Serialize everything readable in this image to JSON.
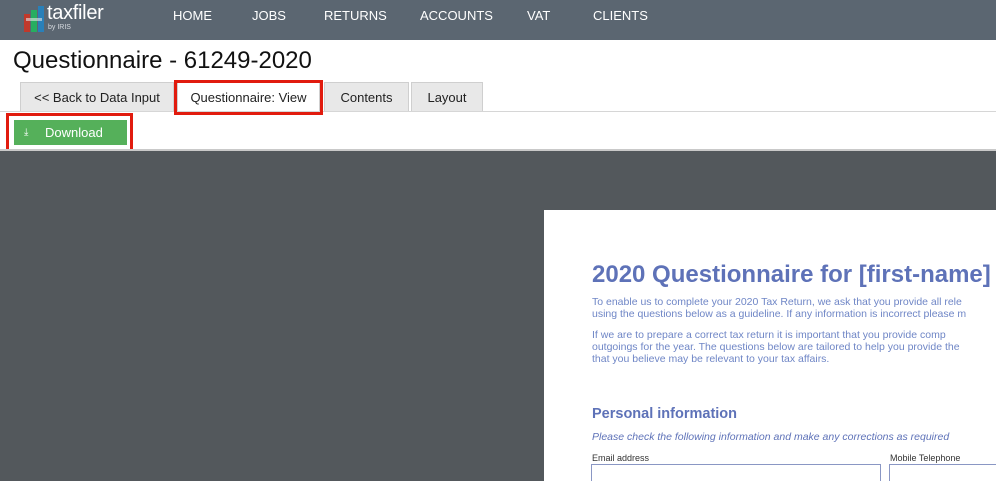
{
  "app": {
    "logo_text": "taxfiler",
    "logo_sub": "by IRIS"
  },
  "nav": {
    "items": [
      "HOME",
      "JOBS",
      "RETURNS",
      "ACCOUNTS",
      "VAT",
      "CLIENTS"
    ]
  },
  "page": {
    "title": "Questionnaire - 61249-2020"
  },
  "tabs": [
    {
      "label": "<< Back to Data Input"
    },
    {
      "label": "Questionnaire: View",
      "active": true
    },
    {
      "label": "Contents"
    },
    {
      "label": "Layout"
    }
  ],
  "toolbar": {
    "download_label": "Download",
    "download_icon": "download-icon"
  },
  "colors": {
    "nav_bg": "#5b6671",
    "accent_green": "#55b05a",
    "highlight_red": "#e11b0e",
    "viewer_bg": "#53585c",
    "doc_blue": "#5e72b8"
  },
  "document": {
    "title": "2020 Questionnaire for [first-name]",
    "paragraph1_line1": "To enable us to complete your 2020 Tax Return, we ask that you provide all rele",
    "paragraph1_line2": "using the questions below as a guideline. If any information is incorrect please m",
    "paragraph2_line1": "If we are to prepare a correct tax return it is important that you provide comp",
    "paragraph2_line2": "outgoings for the year. The questions below are tailored to help you provide the",
    "paragraph2_line3": "that you believe may be relevant to your tax affairs.",
    "section_title": "Personal information",
    "section_note": "Please check the following information and make any corrections as required",
    "fields": [
      {
        "label": "Email address",
        "value": ""
      },
      {
        "label": "Mobile Telephone",
        "value": ""
      }
    ]
  }
}
